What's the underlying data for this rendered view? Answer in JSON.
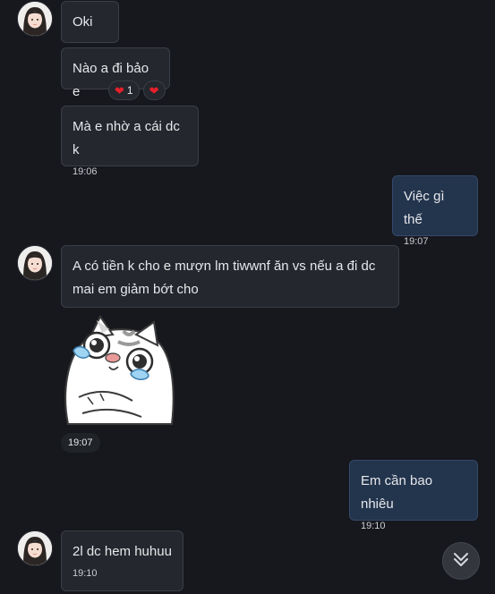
{
  "messages": [
    {
      "id": "m1",
      "text": "Oki"
    },
    {
      "id": "m2",
      "text": "Nào a đi bảo e",
      "reactions": [
        {
          "emoji": "❤️",
          "count": "1"
        },
        {
          "emoji": "❤️"
        }
      ]
    },
    {
      "id": "m3",
      "text": "Mà e nhờ a cái dc k",
      "time": "19:06"
    },
    {
      "id": "m4",
      "text": "Việc gì thế",
      "time": "19:07"
    },
    {
      "id": "m5",
      "text_line1": "A có tiền k cho e mượn lm tiwwnf ăn vs nếu a đi dc",
      "text_line2": "mai em giảm bớt cho"
    },
    {
      "id": "m6",
      "sticker": "crying-cat-sticker",
      "time": "19:07"
    },
    {
      "id": "m7",
      "text": "Em cần bao nhiêu",
      "time": "19:10"
    },
    {
      "id": "m8",
      "text": "2l dc hem huhuu",
      "time": "19:10"
    }
  ],
  "colors": {
    "background": "#16181d",
    "incoming_bubble": "#24272d",
    "outgoing_bubble": "#23344d",
    "heart": "#e5202b"
  },
  "icons": {
    "scroll_down": "double-chevron-down-icon"
  }
}
